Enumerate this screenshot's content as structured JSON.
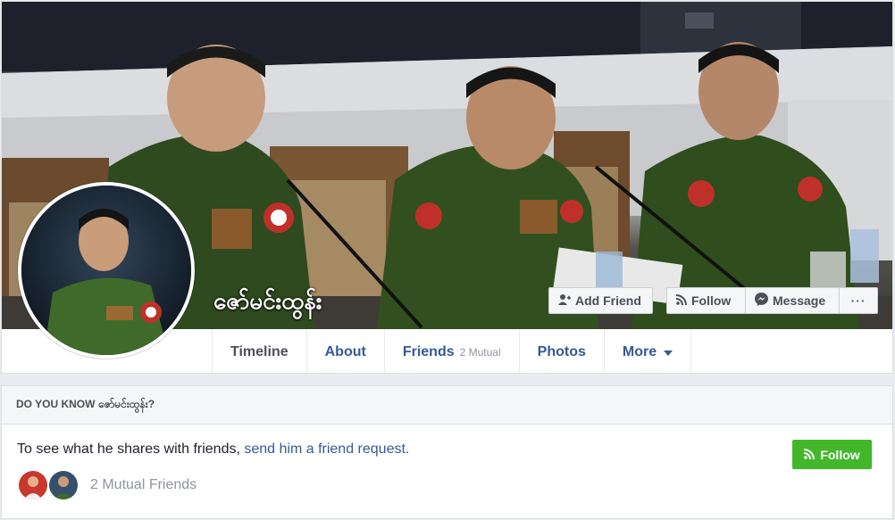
{
  "profile": {
    "name": "ဇော်မင်းထွန်း"
  },
  "actions": {
    "add_friend": "Add Friend",
    "follow": "Follow",
    "message": "Message",
    "more": "···"
  },
  "tabs": [
    {
      "label": "Timeline"
    },
    {
      "label": "About"
    },
    {
      "label": "Friends",
      "sub": "2 Mutual"
    },
    {
      "label": "Photos"
    },
    {
      "label": "More"
    }
  ],
  "know": {
    "heading": "DO YOU KNOW ဇော်မင်းထွန်း?",
    "text": "To see what he shares with friends, ",
    "link": "send him a friend request.",
    "mutual": "2 Mutual Friends",
    "follow_label": "Follow"
  },
  "colors": {
    "link": "#365899",
    "follow_green": "#42b72a",
    "page_bg": "#e9ebee"
  },
  "icons": [
    "add-friend-icon",
    "rss-icon",
    "messenger-icon",
    "caret-down-icon"
  ]
}
